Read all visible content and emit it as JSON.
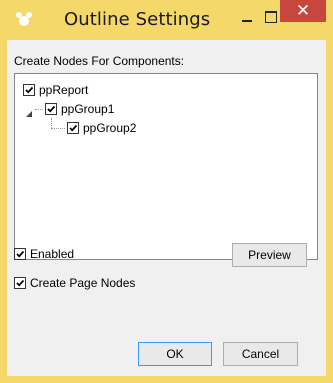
{
  "window": {
    "title": "Outline Settings",
    "icons": {
      "app": "sparkle-app-icon",
      "minimize": "minimize-icon",
      "maximize": "maximize-icon",
      "close": "close-icon"
    },
    "close_glyph": "✕",
    "colors": {
      "titlebar": "#f4d86a",
      "close": "#c7463d",
      "client": "#f0f0f0"
    }
  },
  "group_label": "Create Nodes For Components:",
  "tree": {
    "items": [
      {
        "label": "ppReport",
        "checked": true
      },
      {
        "label": "ppGroup1",
        "checked": true,
        "expanded": true
      },
      {
        "label": "ppGroup2",
        "checked": true
      }
    ]
  },
  "options": {
    "enabled": {
      "label": "Enabled",
      "checked": true
    },
    "create_page_nodes": {
      "label": "Create Page Nodes",
      "checked": true
    }
  },
  "buttons": {
    "preview": "Preview",
    "ok": "OK",
    "cancel": "Cancel"
  }
}
